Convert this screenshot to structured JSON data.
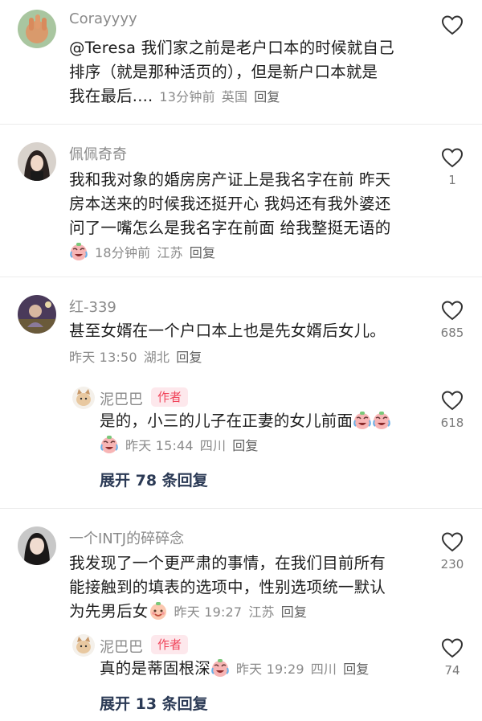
{
  "comments": [
    {
      "username": "Corayyyy",
      "lines": [
        "@Teresa  我们家之前是老户口本的时候就自己",
        "排序（就是那种活页的），但是新户口本就是",
        "我在最后...."
      ],
      "time": "13分钟前",
      "location": "英国",
      "reply_label": "回复",
      "likes": ""
    },
    {
      "username": "佩佩奇奇",
      "lines": [
        "我和我对象的婚房房产证上是我名字在前 昨天",
        "房本送来的时候我还挺开心 我妈还有我外婆还",
        "问了一嘴怎么是我名字在前面 给我整挺无语的"
      ],
      "time": "18分钟前",
      "location": "江苏",
      "reply_label": "回复",
      "likes": "1",
      "emoji": "crying-laughing-emoji"
    },
    {
      "username": "红-339",
      "lines": [
        "甚至女婿在一个户口本上也是先女婿后女儿。"
      ],
      "time": "昨天 13:50",
      "location": "湖北",
      "reply_label": "回复",
      "likes": "685",
      "reply": {
        "username": "泥巴巴",
        "author_tag": "作者",
        "text": "是的，小三的儿子在正妻的女儿前面",
        "time": "昨天 15:44",
        "location": "四川",
        "reply_label": "回复",
        "likes": "618"
      },
      "expand_label": "展开 78 条回复"
    },
    {
      "username": "一个INTJ的碎碎念",
      "lines": [
        "我发现了一个更严肃的事情，在我们目前所有",
        "能接触到的填表的选项中，性别选项统一默认",
        "为先男后女"
      ],
      "time": "昨天 19:27",
      "location": "江苏",
      "reply_label": "回复",
      "likes": "230",
      "reply": {
        "username": "泥巴巴",
        "author_tag": "作者",
        "text": "真的是蒂固根深",
        "time": "昨天 19:29",
        "location": "四川",
        "reply_label": "回复",
        "likes": "74"
      },
      "expand_label": "展开 13 条回复"
    }
  ]
}
